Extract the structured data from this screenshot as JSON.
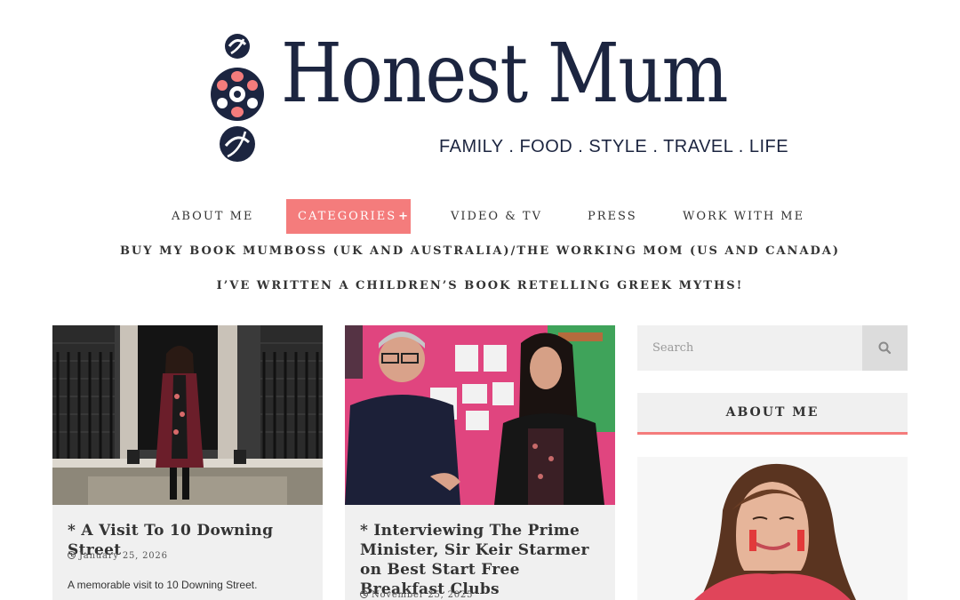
{
  "header": {
    "site_title": "Honest Mum",
    "tagline": "FAMILY . FOOD . STYLE . TRAVEL . LIFE"
  },
  "nav": {
    "items": [
      {
        "label": "About Me"
      },
      {
        "label": "Categories",
        "active": true
      },
      {
        "label": "Video & TV"
      },
      {
        "label": "Press"
      },
      {
        "label": "Work With Me"
      }
    ],
    "book_link": "Buy my book MUMBOSS (UK and Australia)/The Working Mom (US and Canada)",
    "children_book_link": "I’ve written a children’s book retelling Greek myths!"
  },
  "posts": [
    {
      "title": "* A Visit To 10 Downing Street",
      "date": "January 25, 2026",
      "excerpt": "A memorable visit to 10 Downing Street."
    },
    {
      "title": "* Interviewing The Prime Minister, Sir Keir Starmer on Best Start Free Breakfast Clubs",
      "date": "November 25, 2025",
      "excerpt": ""
    }
  ],
  "sidebar": {
    "search_placeholder": "Search",
    "about_heading": "ABOUT ME"
  },
  "icons": {
    "search": "search-icon",
    "clock": "clock-icon",
    "plus": "plus-icon"
  },
  "colors": {
    "accent": "#f47c7c",
    "navy": "#1c2540",
    "card_bg": "#f0f0f0"
  }
}
